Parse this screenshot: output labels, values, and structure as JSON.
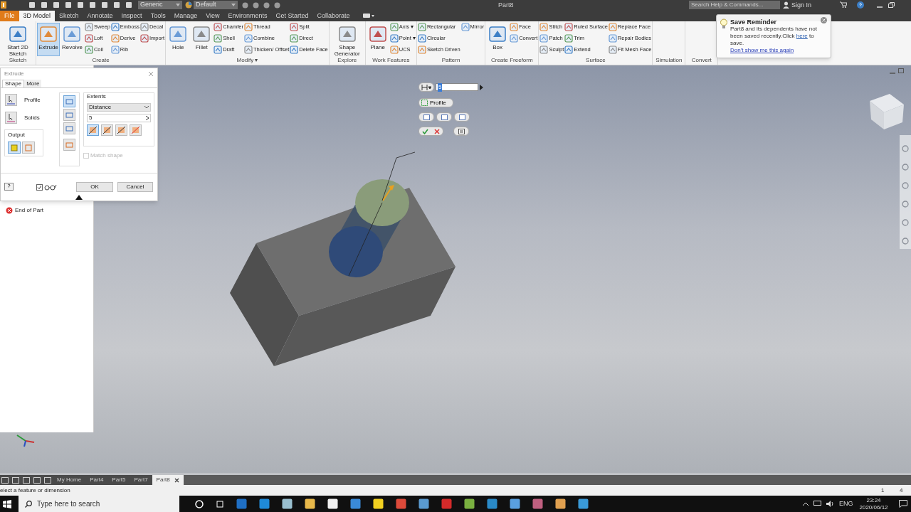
{
  "title_bar": {
    "material": "Generic",
    "appearance": "Default",
    "title": "Part8",
    "search": {
      "placeholder": "Search Help & Commands..."
    },
    "sign_in": "Sign In"
  },
  "ribbon_tabs": [
    {
      "label": "File",
      "kind": "file",
      "selected": false
    },
    {
      "label": "3D Model",
      "kind": "tab",
      "selected": true
    },
    {
      "label": "Sketch",
      "kind": "tab",
      "selected": false
    },
    {
      "label": "Annotate",
      "kind": "tab",
      "selected": false
    },
    {
      "label": "Inspect",
      "kind": "tab",
      "selected": false
    },
    {
      "label": "Tools",
      "kind": "tab",
      "selected": false
    },
    {
      "label": "Manage",
      "kind": "tab",
      "selected": false
    },
    {
      "label": "View",
      "kind": "tab",
      "selected": false
    },
    {
      "label": "Environments",
      "kind": "tab",
      "selected": false
    },
    {
      "label": "Get Started",
      "kind": "tab",
      "selected": false
    },
    {
      "label": "Collaborate",
      "kind": "tab",
      "selected": false
    }
  ],
  "ribbon_groups": [
    {
      "label": "Sketch",
      "tools": [
        {
          "label": "Start 2D Sketch",
          "kind": "large",
          "active": false
        }
      ]
    },
    {
      "label": "Create",
      "tools": [
        {
          "label": "Extrude",
          "kind": "large",
          "active": true
        },
        {
          "label": "Revolve",
          "kind": "large",
          "active": false
        },
        {
          "label": "Sweep",
          "kind": "small",
          "active": false
        },
        {
          "label": "Loft",
          "kind": "small",
          "active": false
        },
        {
          "label": "Coil",
          "kind": "small",
          "active": false
        },
        {
          "label": "Emboss",
          "kind": "small",
          "active": false
        },
        {
          "label": "Derive",
          "kind": "small",
          "active": false
        },
        {
          "label": "Rib",
          "kind": "small",
          "active": false
        },
        {
          "label": "Decal",
          "kind": "small",
          "active": false
        },
        {
          "label": "Import",
          "kind": "small",
          "active": false
        }
      ]
    },
    {
      "label": "Modify ▾",
      "tools": [
        {
          "label": "Hole",
          "kind": "large",
          "active": false
        },
        {
          "label": "Fillet",
          "kind": "large",
          "active": false
        },
        {
          "label": "Chamfer",
          "kind": "small",
          "active": false
        },
        {
          "label": "Shell",
          "kind": "small",
          "active": false
        },
        {
          "label": "Draft",
          "kind": "small",
          "active": false
        },
        {
          "label": "Thread",
          "kind": "small",
          "active": false
        },
        {
          "label": "Combine",
          "kind": "small",
          "active": false
        },
        {
          "label": "Thicken/ Offset",
          "kind": "small",
          "active": false
        },
        {
          "label": "Split",
          "kind": "small",
          "active": false
        },
        {
          "label": "Direct",
          "kind": "small",
          "active": false
        },
        {
          "label": "Delete Face",
          "kind": "small",
          "active": false
        }
      ]
    },
    {
      "label": "Explore",
      "tools": [
        {
          "label": "Shape Generator",
          "kind": "large",
          "active": false
        }
      ]
    },
    {
      "label": "Work Features",
      "tools": [
        {
          "label": "Plane",
          "kind": "large",
          "active": false
        },
        {
          "label": "Axis ▾",
          "kind": "small",
          "active": false
        },
        {
          "label": "Point ▾",
          "kind": "small",
          "active": false
        },
        {
          "label": "UCS",
          "kind": "small",
          "active": false
        }
      ]
    },
    {
      "label": "Pattern",
      "tools": [
        {
          "label": "Rectangular",
          "kind": "small",
          "active": false
        },
        {
          "label": "Circular",
          "kind": "small",
          "active": false
        },
        {
          "label": "Sketch Driven",
          "kind": "small",
          "active": false
        },
        {
          "label": "Mirror",
          "kind": "small",
          "active": false
        }
      ]
    },
    {
      "label": "Create Freeform",
      "tools": [
        {
          "label": "Box",
          "kind": "large",
          "active": false
        },
        {
          "label": "Face",
          "kind": "small",
          "active": false
        },
        {
          "label": "Convert",
          "kind": "small",
          "active": false
        }
      ]
    },
    {
      "label": "Surface",
      "tools": [
        {
          "label": "Stitch",
          "kind": "small",
          "active": false
        },
        {
          "label": "Patch",
          "kind": "small",
          "active": false
        },
        {
          "label": "Sculpt",
          "kind": "small",
          "active": false
        },
        {
          "label": "Ruled Surface",
          "kind": "small",
          "active": false
        },
        {
          "label": "Trim",
          "kind": "small",
          "active": false
        },
        {
          "label": "Extend",
          "kind": "small",
          "active": false
        },
        {
          "label": "Replace Face",
          "kind": "small",
          "active": false
        },
        {
          "label": "Repair Bodies",
          "kind": "small",
          "active": false
        },
        {
          "label": "Fit Mesh Face",
          "kind": "small",
          "active": false
        }
      ]
    },
    {
      "label": "Simulation"
    },
    {
      "label": "Convert"
    }
  ],
  "save_reminder": {
    "title": "Save Reminder",
    "text_before": "Part8 and its dependents have not been saved recently.Click",
    "link": "here",
    "text_after": "to save.",
    "dont_show": "Don't show me this again"
  },
  "extrude_dialog": {
    "title": "Extrude",
    "tabs": [
      {
        "label": "Shape",
        "selected": true
      },
      {
        "label": "More",
        "selected": false
      }
    ],
    "inputs": [
      {
        "label": "Profile"
      },
      {
        "label": "Solids"
      }
    ],
    "output_label": "Output",
    "outputs": [
      {
        "selected": true
      },
      {
        "selected": false
      }
    ],
    "operations": [
      {
        "selected": true
      },
      {
        "selected": false
      },
      {
        "selected": false
      },
      {
        "selected": false
      }
    ],
    "extents_label": "Extents",
    "extents_type": "Distance",
    "distance": "5",
    "directions": [
      {
        "selected": true
      },
      {
        "selected": false
      },
      {
        "selected": false
      },
      {
        "selected": false
      }
    ],
    "match_shape": {
      "label": "Match shape",
      "checked": false,
      "disabled": true
    },
    "preview_checked": true,
    "ok": "OK",
    "cancel": "Cancel"
  },
  "browser": {
    "items": [
      {
        "label": "End of Part"
      }
    ]
  },
  "mini_toolbar": {
    "distance": "5",
    "profile": "Profile"
  },
  "document_tabs": [
    {
      "label": "My Home",
      "selected": false
    },
    {
      "label": "Part4",
      "selected": false
    },
    {
      "label": "Part5",
      "selected": false
    },
    {
      "label": "Part7",
      "selected": false
    },
    {
      "label": "Part8",
      "selected": true
    }
  ],
  "status_bar": {
    "message": "elect a feature or dimension",
    "count_1": "1",
    "count_2": "4"
  },
  "taskbar": {
    "search": {
      "placeholder": "Type here to search"
    },
    "language": "ENG",
    "time": "23:24",
    "date": "2020/06/12"
  }
}
